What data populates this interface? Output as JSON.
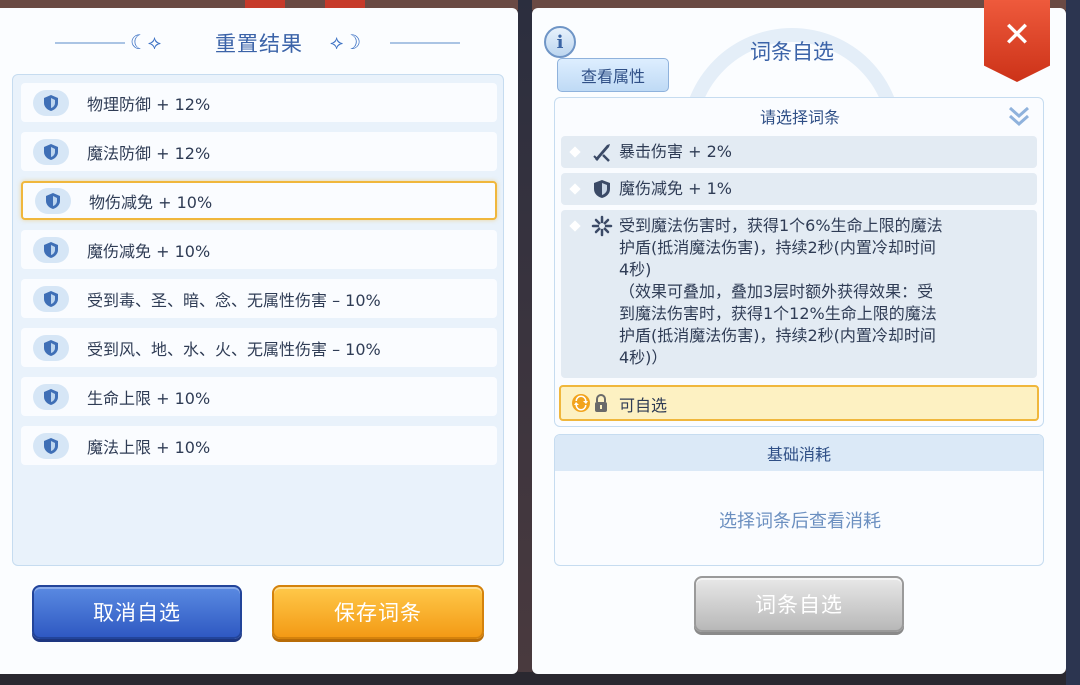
{
  "left_panel": {
    "title": "重置结果",
    "items": [
      {
        "label": "物理防御 + 12%",
        "selected": false
      },
      {
        "label": "魔法防御 + 12%",
        "selected": false
      },
      {
        "label": "物伤减免 + 10%",
        "selected": true
      },
      {
        "label": "魔伤减免 + 10%",
        "selected": false
      },
      {
        "label": "受到毒、圣、暗、念、无属性伤害 – 10%",
        "selected": false
      },
      {
        "label": "受到风、地、水、火、无属性伤害 – 10%",
        "selected": false
      },
      {
        "label": "生命上限 + 10%",
        "selected": false
      },
      {
        "label": "魔法上限 + 10%",
        "selected": false
      }
    ],
    "cancel_label": "取消自选",
    "save_label": "保存词条"
  },
  "right_panel": {
    "title": "词条自选",
    "view_attr_label": "查看属性",
    "select_header": "请选择词条",
    "options": [
      {
        "icon": "sword-icon",
        "label": "暴击伤害 + 2%"
      },
      {
        "icon": "shield-icon",
        "label": "魔伤减免 + 1%"
      },
      {
        "icon": "spark-icon",
        "label": "受到魔法伤害时，获得1个6%生命上限的魔法\n护盾(抵消魔法伤害)，持续2秒(内置冷却时间\n4秒)\n（效果可叠加，叠加3层时额外获得效果：受\n到魔法伤害时，获得1个12%生命上限的魔法\n护盾(抵消魔法伤害)，持续2秒(内置冷却时间\n4秒)）"
      }
    ],
    "selectable_label": "可自选",
    "cost_header": "基础消耗",
    "cost_hint": "选择词条后查看消耗",
    "pick_label": "词条自选"
  },
  "colors": {
    "title_blue": "#3b63a8",
    "selected_border": "#f0b73c",
    "cancel_button": "#3a66cc",
    "save_button": "#f5a623",
    "close_button": "#dd4428"
  }
}
